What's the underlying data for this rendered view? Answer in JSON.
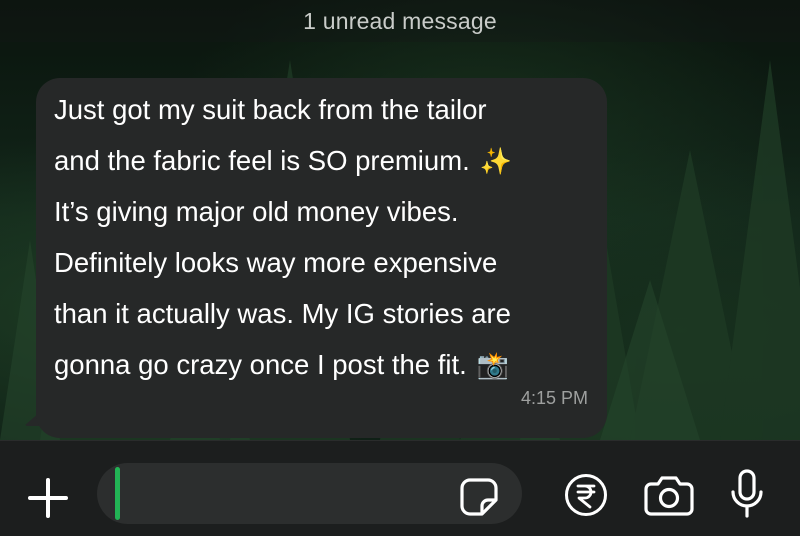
{
  "banner": {
    "unread_text": "1 unread message"
  },
  "message": {
    "lines": [
      "Just got my suit back from the tailor",
      "and the fabric feel is SO premium.",
      "It’s giving major old money vibes.",
      "Definitely looks way more expensive",
      "than it actually was. My IG stories are",
      "gonna go crazy once I post the fit."
    ],
    "emoji_sparkles": "✨",
    "emoji_camera": "📸",
    "time": "4:15 PM"
  },
  "composer": {
    "text_value": "",
    "icons": [
      "plus-icon",
      "sticker-icon",
      "rupee-icon",
      "camera-icon",
      "microphone-icon"
    ],
    "caret_color": "#22b455"
  },
  "colors": {
    "bubble": "#262828",
    "input_bar": "#1c1e1e",
    "accent": "#22b455"
  }
}
